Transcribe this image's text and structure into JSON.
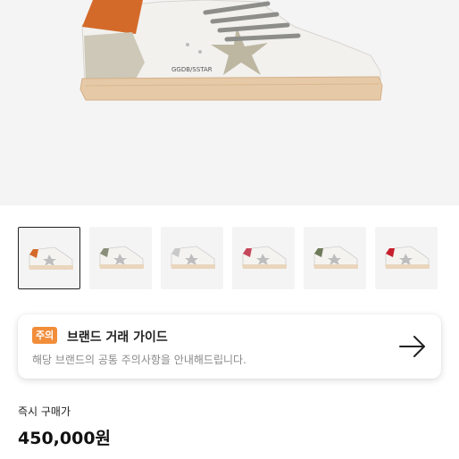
{
  "guide": {
    "badge": "주의",
    "title": "브랜드 거래 가이드",
    "description": "해당 브랜드의 공통 주의사항을 안내해드립니다.",
    "arrow_icon": "arrow-right-icon"
  },
  "price": {
    "label": "즉시 구매가",
    "value": "450,000원"
  },
  "product_text": {
    "logo_text": "GGDB/SSTAR"
  },
  "thumbnails": [
    {
      "accent": "#d46a2a",
      "active": true
    },
    {
      "accent": "#8a8f7a",
      "active": false
    },
    {
      "accent": "#c9c9c9",
      "active": false
    },
    {
      "accent": "#c4475a",
      "active": false
    },
    {
      "accent": "#6f7a5a",
      "active": false
    },
    {
      "accent": "#c6202c",
      "active": false
    }
  ],
  "colors": {
    "badge": "#f28d3a",
    "heel_tab": "#d46a2a",
    "sole": "#e6c9a6"
  }
}
